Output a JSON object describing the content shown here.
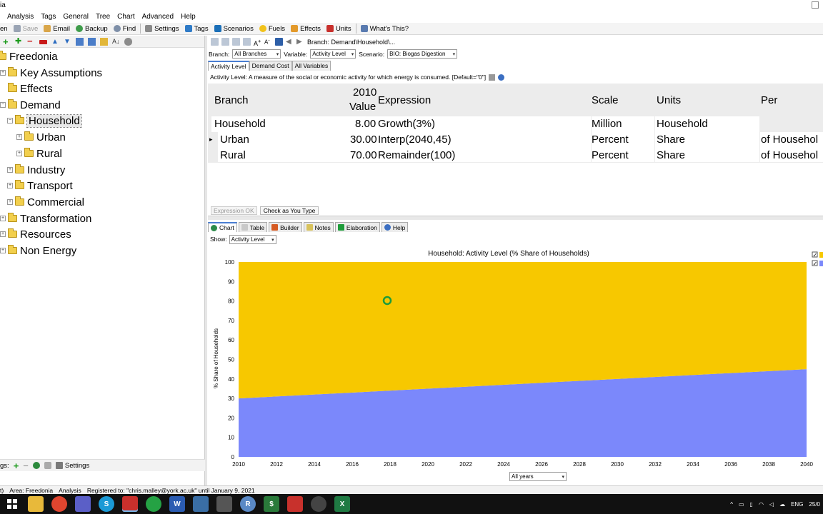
{
  "window": {
    "title_fragment": "ia"
  },
  "menu": [
    "Analysis",
    "Tags",
    "General",
    "Tree",
    "Chart",
    "Advanced",
    "Help"
  ],
  "toolbar": {
    "partial_left": "en",
    "items": [
      {
        "label": "Save",
        "icon": "save-icon",
        "disabled": true
      },
      {
        "label": "Email",
        "icon": "email-icon"
      },
      {
        "label": "Backup",
        "icon": "backup-icon"
      },
      {
        "label": "Find",
        "icon": "find-icon"
      },
      {
        "label": "Settings",
        "icon": "settings-icon"
      },
      {
        "label": "Tags",
        "icon": "tags-icon"
      },
      {
        "label": "Scenarios",
        "icon": "scenarios-icon"
      },
      {
        "label": "Fuels",
        "icon": "fuels-icon"
      },
      {
        "label": "Effects",
        "icon": "effects-icon"
      },
      {
        "label": "Units",
        "icon": "units-icon"
      },
      {
        "label": "What's This?",
        "icon": "whats-this-icon"
      }
    ]
  },
  "tree": {
    "nodes": [
      {
        "label": "Freedonia",
        "level": 0
      },
      {
        "label": "Key Assumptions",
        "level": 1
      },
      {
        "label": "Effects",
        "level": 1
      },
      {
        "label": "Demand",
        "level": 1
      },
      {
        "label": "Household",
        "level": 2,
        "selected": true
      },
      {
        "label": "Urban",
        "level": 3
      },
      {
        "label": "Rural",
        "level": 3
      },
      {
        "label": "Industry",
        "level": 2
      },
      {
        "label": "Transport",
        "level": 2
      },
      {
        "label": "Commercial",
        "level": 2
      },
      {
        "label": "Transformation",
        "level": 1
      },
      {
        "label": "Resources",
        "level": 1
      },
      {
        "label": "Non Energy",
        "level": 1
      }
    ],
    "bottom": {
      "tags_label": "gs:",
      "settings_label": "Settings"
    }
  },
  "nav": {
    "branch_path": "Branch: Demand\\Household\\..."
  },
  "selectors": {
    "branch_label": "Branch:",
    "branch_value": "All Branches",
    "variable_label": "Variable:",
    "variable_value": "Activity Level",
    "scenario_label": "Scenario:",
    "scenario_value": "BIO: Biogas Digestion"
  },
  "tabs_top": [
    "Activity Level",
    "Demand Cost",
    "All Variables"
  ],
  "description": "Activity Level: A measure of the social or economic activity for which energy is consumed. [Default=\"0\"]",
  "grid": {
    "headers": {
      "branch": "Branch",
      "value_top": "2010",
      "value_bottom": "Value",
      "expression": "Expression",
      "scale": "Scale",
      "units": "Units",
      "per": "Per"
    },
    "rows": [
      {
        "branch": "Household",
        "value": "8.00",
        "expression": "Growth(3%)",
        "scale": "Million",
        "units": "Household",
        "per": ""
      },
      {
        "branch": "Urban",
        "value": "30.00",
        "expression": "Interp(2040,45)",
        "scale": "Percent",
        "units": "Share",
        "per": "of Househol"
      },
      {
        "branch": "Rural",
        "value": "70.00",
        "expression": "Remainder(100)",
        "scale": "Percent",
        "units": "Share",
        "per": "of Househol"
      }
    ]
  },
  "expr_bar": {
    "status": "Expression OK",
    "check": "Check as You Type"
  },
  "tabs_bottom": [
    {
      "label": "Chart",
      "icon": "chart-icon",
      "active": true
    },
    {
      "label": "Table",
      "icon": "table-icon"
    },
    {
      "label": "Builder",
      "icon": "builder-icon"
    },
    {
      "label": "Notes",
      "icon": "notes-icon"
    },
    {
      "label": "Elaboration",
      "icon": "elaboration-icon"
    },
    {
      "label": "Help",
      "icon": "help-icon"
    }
  ],
  "show": {
    "label": "Show:",
    "value": "Activity Level"
  },
  "years_select": "All years",
  "chart_data": {
    "type": "area",
    "stacked": true,
    "title": "Household: Activity Level (% Share of Households)",
    "ylabel": "% Share of Households",
    "xlabel": "",
    "x": [
      2010,
      2040
    ],
    "xticks": [
      2010,
      2012,
      2014,
      2016,
      2018,
      2020,
      2022,
      2024,
      2026,
      2028,
      2030,
      2032,
      2034,
      2036,
      2038,
      2040
    ],
    "yticks": [
      0,
      10,
      20,
      30,
      40,
      50,
      60,
      70,
      80,
      90,
      100
    ],
    "ylim": [
      0,
      100
    ],
    "xlim": [
      2010,
      2040
    ],
    "series": [
      {
        "values": [
          30,
          45
        ],
        "color": "#7b88fb"
      },
      {
        "values": [
          70,
          55
        ],
        "color": "#f7c800"
      }
    ],
    "grid": false,
    "legend": "top-right"
  },
  "status": {
    "area": "Area: Freedonia",
    "view": "Analysis",
    "registration": "Registered to: \"chris.malley@york.ac.uk\" until January 9, 2021",
    "left": "t)"
  },
  "taskbar": {
    "lang": "ENG",
    "date_partial": "25/0"
  }
}
